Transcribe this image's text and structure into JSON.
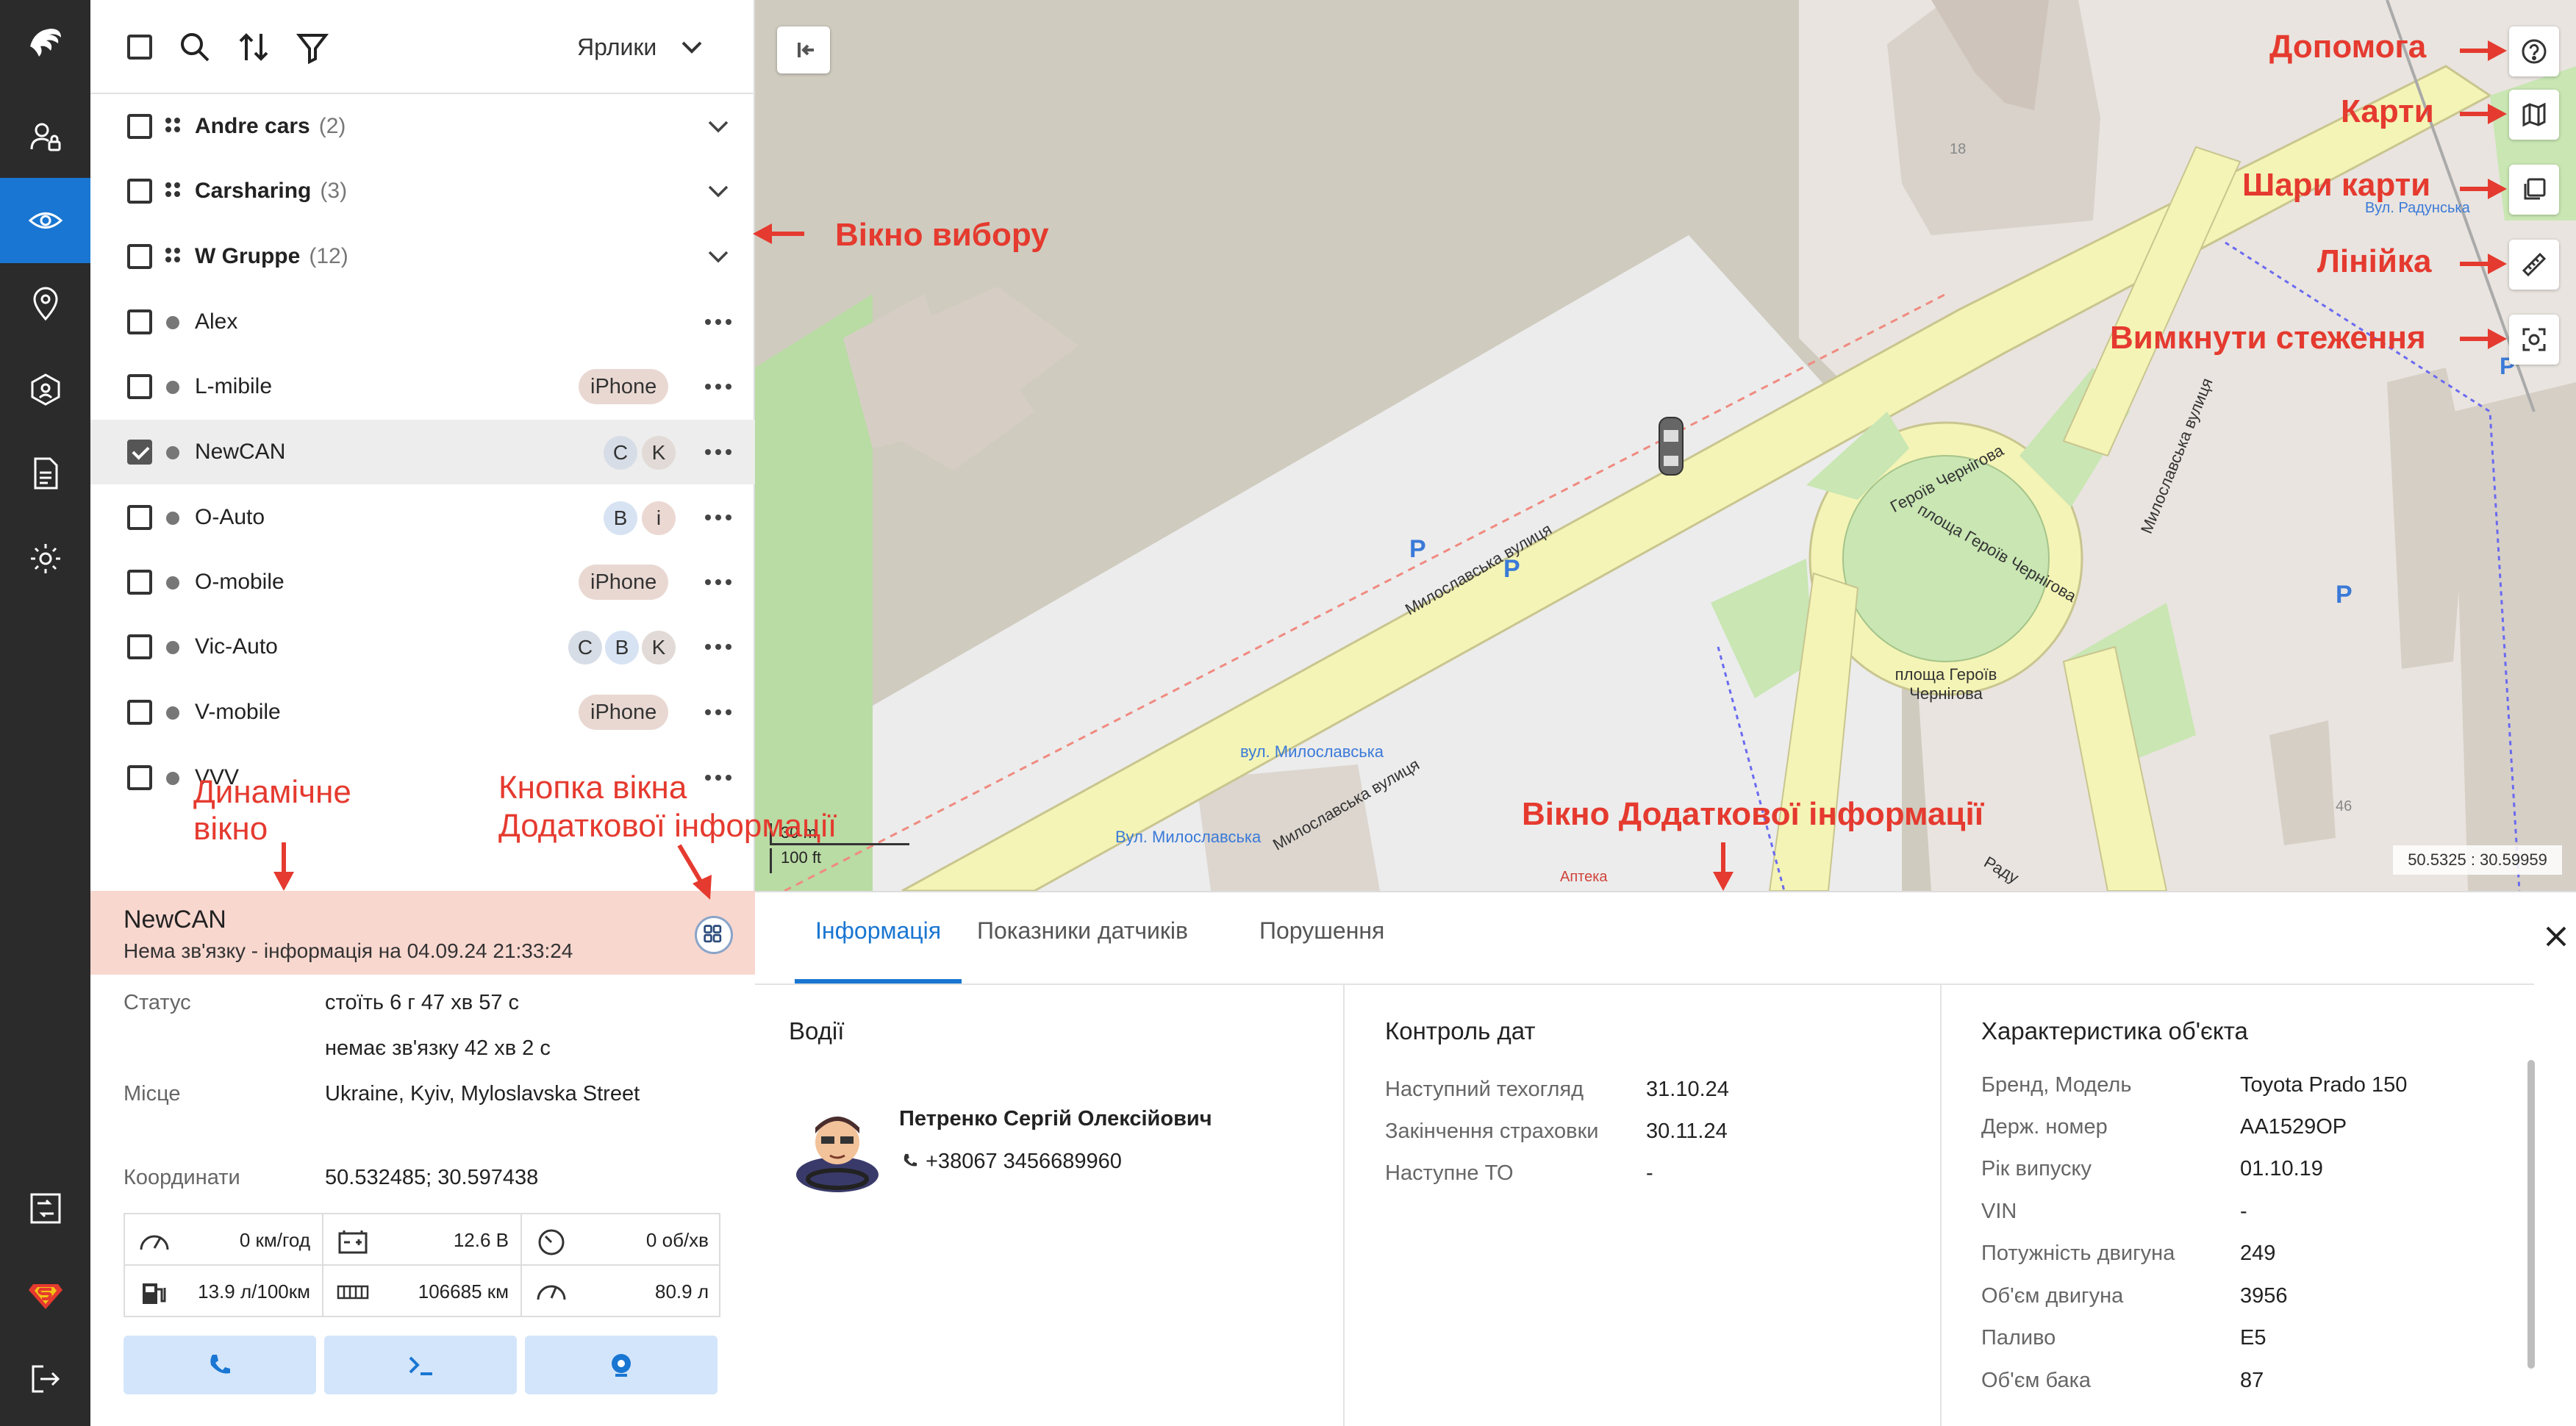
{
  "toolbar": {
    "labels_select": "Ярлики"
  },
  "groups": [
    {
      "name": "Andre cars",
      "count": "(2)"
    },
    {
      "name": "Carsharing",
      "count": "(3)"
    },
    {
      "name": "W Gruppe",
      "count": "(12)"
    }
  ],
  "units": [
    {
      "name": "Alex"
    },
    {
      "name": "L-mibile",
      "pill": "iPhone"
    },
    {
      "name": "NewCAN",
      "tags": [
        "C",
        "K"
      ],
      "selected": true
    },
    {
      "name": "O-Auto",
      "tags": [
        "B",
        "i"
      ]
    },
    {
      "name": "O-mobile",
      "pill": "iPhone"
    },
    {
      "name": "Vic-Auto",
      "tags": [
        "C",
        "B",
        "K"
      ]
    },
    {
      "name": "V-mobile",
      "pill": "iPhone"
    },
    {
      "name": "VVV"
    }
  ],
  "annotations": {
    "selection_window": "Вікно вибору",
    "dynamic_window_l1": "Динамічне",
    "dynamic_window_l2": "вікно",
    "info_button_l1": "Кнопка вікна",
    "info_button_l2": "Додаткової інформації",
    "info_window": "Вікно Додаткової інформації",
    "help": "Допомога",
    "maps": "Карти",
    "map_layers": "Шари карти",
    "ruler": "Лінійка",
    "tracking_off": "Вимкнути стеження"
  },
  "status": {
    "name": "NewCAN",
    "connection": "Нема зв'язку - інформація на 04.09.24 21:33:24",
    "status_label": "Статус",
    "status_line1": "стоїть 6 г 47 хв 57 с",
    "status_line2": "немає зв'язку 42 хв 2 с",
    "place_label": "Місце",
    "place_value": "Ukraine, Kyiv, Myloslavska Street",
    "coords_label": "Координати",
    "coords_value": "50.532485; 30.597438"
  },
  "metrics": {
    "speed": "0 км/год",
    "voltage": "12.6 В",
    "rpm": "0 об/хв",
    "consumption": "13.9 л/100км",
    "mileage": "106685 км",
    "fuel": "80.9 л"
  },
  "map": {
    "street1": "Милославська вулиця",
    "street2": "Милославська вулиця",
    "street3": "площа Героїв Чернігова",
    "street4": "Героїв Чернігова",
    "street5": "Милославська вулиця",
    "square": "площа Героїв Чернігова",
    "stop1": "вул. Милославська",
    "stop2": "Вул. Милославська",
    "radunska": "Вул. Радунська",
    "pharmacy": "Аптека",
    "bldg18": "18",
    "bldg46": "46",
    "radu": "Раду",
    "scale_m": "30 m",
    "scale_ft": "100 ft",
    "coord_readout": "50.5325 : 30.59959"
  },
  "info": {
    "tabs": [
      "Інформація",
      "Показники датчиків",
      "Порушення"
    ],
    "drivers_title": "Водії",
    "driver_name": "Петренко Сергій Олексійович",
    "driver_phone": "+38067 3456689960",
    "dates_title": "Контроль дат",
    "dates": [
      {
        "label": "Наступний техогляд",
        "value": "31.10.24"
      },
      {
        "label": "Закінчення страховки",
        "value": "30.11.24"
      },
      {
        "label": "Наступне ТО",
        "value": "-"
      }
    ],
    "char_title": "Характеристика об'єкта",
    "chars": [
      {
        "label": "Бренд, Модель",
        "value": "Toyota Prado 150"
      },
      {
        "label": "Держ. номер",
        "value": "AA1529OP"
      },
      {
        "label": "Рік випуску",
        "value": "01.10.19"
      },
      {
        "label": "VIN",
        "value": "-"
      },
      {
        "label": "Потужність двигуна",
        "value": "249"
      },
      {
        "label": "Об'єм двигуна",
        "value": "3956"
      },
      {
        "label": "Паливо",
        "value": "E5"
      },
      {
        "label": "Об'єм бака",
        "value": "87"
      }
    ]
  },
  "colors": {
    "accent": "#1976d2",
    "annotation": "#e53a2f",
    "status_bg": "#f8d7cf",
    "rail": "#2b2b2b"
  }
}
